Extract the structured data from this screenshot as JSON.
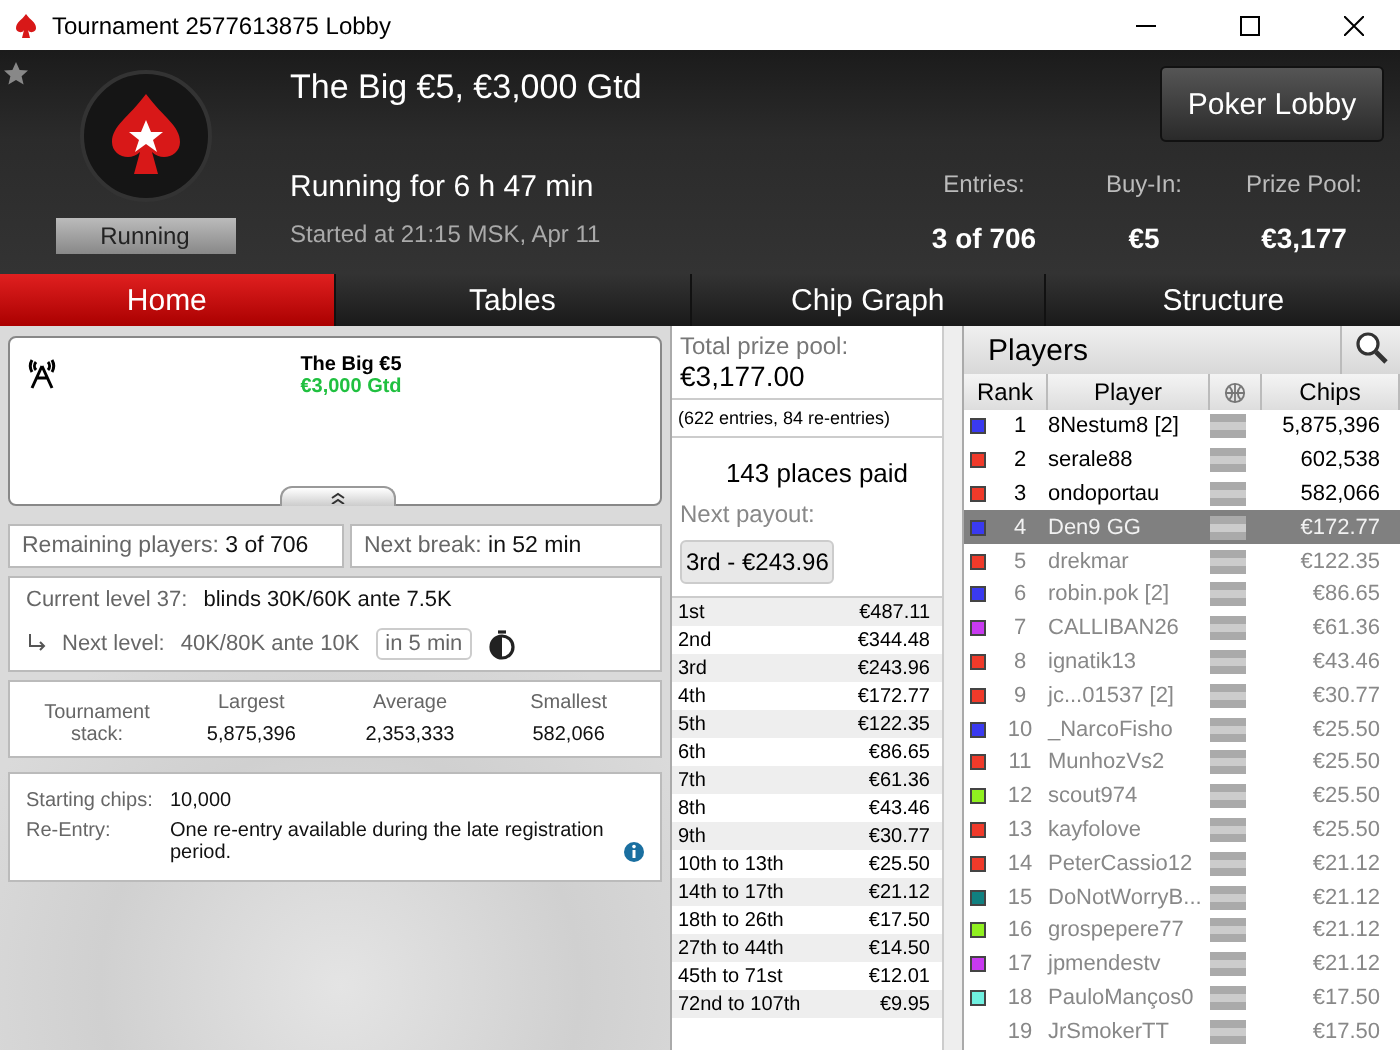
{
  "window": {
    "title": "Tournament 2577613875 Lobby"
  },
  "header": {
    "title": "The Big €5, €3,000 Gtd",
    "status": "Running",
    "running_for": "Running for 6 h 47 min",
    "started": "Started at 21:15 MSK, Apr 11",
    "lobby_button": "Poker Lobby",
    "stats": [
      {
        "label": "Entries:",
        "value": "3 of 706"
      },
      {
        "label": "Buy-In:",
        "value": "€5"
      },
      {
        "label": "Prize Pool:",
        "value": "€3,177"
      }
    ]
  },
  "tabs": [
    {
      "label": "Home",
      "selected": true
    },
    {
      "label": "Tables",
      "selected": false
    },
    {
      "label": "Chip Graph",
      "selected": false
    },
    {
      "label": "Structure",
      "selected": false
    }
  ],
  "home": {
    "card_title": "The Big €5",
    "card_subtitle": "€3,000 Gtd",
    "remaining_label": "Remaining players:",
    "remaining_value": "3 of 706",
    "break_label": "Next break:",
    "break_value": "in 52 min",
    "level_label": "Current level 37:",
    "level_value": "blinds 30K/60K ante 7.5K",
    "next_label": "Next level:",
    "next_value": "40K/80K ante 10K",
    "next_time": "in 5 min",
    "stack_label": "Tournament stack:",
    "stack": [
      {
        "label": "Largest",
        "value": "5,875,396"
      },
      {
        "label": "Average",
        "value": "2,353,333"
      },
      {
        "label": "Smallest",
        "value": "582,066"
      }
    ],
    "info": [
      {
        "label": "Starting chips:",
        "value": "10,000",
        "info": false
      },
      {
        "label": "Re-Entry:",
        "value": "One re-entry available during the late registration period.",
        "info": true
      }
    ]
  },
  "prizes": {
    "total_label": "Total prize pool:",
    "total": "€3,177.00",
    "entries": "(622 entries, 84 re-entries)",
    "paid": "143 places paid",
    "next_label": "Next payout:",
    "next_value": "3rd - €243.96",
    "payouts": [
      [
        "1st",
        "€487.11"
      ],
      [
        "2nd",
        "€344.48"
      ],
      [
        "3rd",
        "€243.96"
      ],
      [
        "4th",
        "€172.77"
      ],
      [
        "5th",
        "€122.35"
      ],
      [
        "6th",
        "€86.65"
      ],
      [
        "7th",
        "€61.36"
      ],
      [
        "8th",
        "€43.46"
      ],
      [
        "9th",
        "€30.77"
      ],
      [
        "10th to 13th",
        "€25.50"
      ],
      [
        "14th to 17th",
        "€21.12"
      ],
      [
        "18th to 26th",
        "€17.50"
      ],
      [
        "27th to 44th",
        "€14.50"
      ],
      [
        "45th to 71st",
        "€12.01"
      ],
      [
        "72nd to 107th",
        "€9.95"
      ]
    ]
  },
  "players": {
    "title": "Players",
    "columns": [
      "Rank",
      "Player",
      "Chips"
    ],
    "rows": [
      {
        "rank": "1",
        "name": "8Nestum8 [2]",
        "chips": "5,875,396",
        "color": "#3a3af0",
        "eliminated": false,
        "selected": false
      },
      {
        "rank": "2",
        "name": "serale88",
        "chips": "602,538",
        "color": "#f03a2a",
        "eliminated": false,
        "selected": false
      },
      {
        "rank": "3",
        "name": "ondoportau",
        "chips": "582,066",
        "color": "#f03a2a",
        "eliminated": false,
        "selected": false
      },
      {
        "rank": "4",
        "name": "Den9 GG",
        "chips": "€172.77",
        "color": "#3a3af0",
        "eliminated": true,
        "selected": true
      },
      {
        "rank": "5",
        "name": "drekmar",
        "chips": "€122.35",
        "color": "#f03a2a",
        "eliminated": true,
        "selected": false
      },
      {
        "rank": "6",
        "name": "robin.pok [2]",
        "chips": "€86.65",
        "color": "#3a3af0",
        "eliminated": true,
        "selected": false
      },
      {
        "rank": "7",
        "name": "CALLIBAN26",
        "chips": "€61.36",
        "color": "#c83af0",
        "eliminated": true,
        "selected": false
      },
      {
        "rank": "8",
        "name": "ignatik13",
        "chips": "€43.46",
        "color": "#f03a2a",
        "eliminated": true,
        "selected": false
      },
      {
        "rank": "9",
        "name": "jc...01537 [2]",
        "chips": "€30.77",
        "color": "#f03a2a",
        "eliminated": true,
        "selected": false
      },
      {
        "rank": "10",
        "name": "_NarcoFisho",
        "chips": "€25.50",
        "color": "#3a3af0",
        "eliminated": true,
        "selected": false
      },
      {
        "rank": "11",
        "name": "MunhozVs2",
        "chips": "€25.50",
        "color": "#f03a2a",
        "eliminated": true,
        "selected": false
      },
      {
        "rank": "12",
        "name": "scout974",
        "chips": "€25.50",
        "color": "#90f020",
        "eliminated": true,
        "selected": false
      },
      {
        "rank": "13",
        "name": "kayfolove",
        "chips": "€25.50",
        "color": "#f03a2a",
        "eliminated": true,
        "selected": false
      },
      {
        "rank": "14",
        "name": "PeterCassio12",
        "chips": "€21.12",
        "color": "#f03a2a",
        "eliminated": true,
        "selected": false
      },
      {
        "rank": "15",
        "name": "DoNotWorryB...",
        "chips": "€21.12",
        "color": "#108080",
        "eliminated": true,
        "selected": false
      },
      {
        "rank": "16",
        "name": "grospepere77",
        "chips": "€21.12",
        "color": "#90f020",
        "eliminated": true,
        "selected": false
      },
      {
        "rank": "17",
        "name": "jpmendestv",
        "chips": "€21.12",
        "color": "#c83af0",
        "eliminated": true,
        "selected": false
      },
      {
        "rank": "18",
        "name": "PauloManços0",
        "chips": "€17.50",
        "color": "#70f0e0",
        "eliminated": true,
        "selected": false
      },
      {
        "rank": "19",
        "name": "JrSmokerTT",
        "chips": "€17.50",
        "eliminated": true,
        "selected": false
      }
    ]
  }
}
